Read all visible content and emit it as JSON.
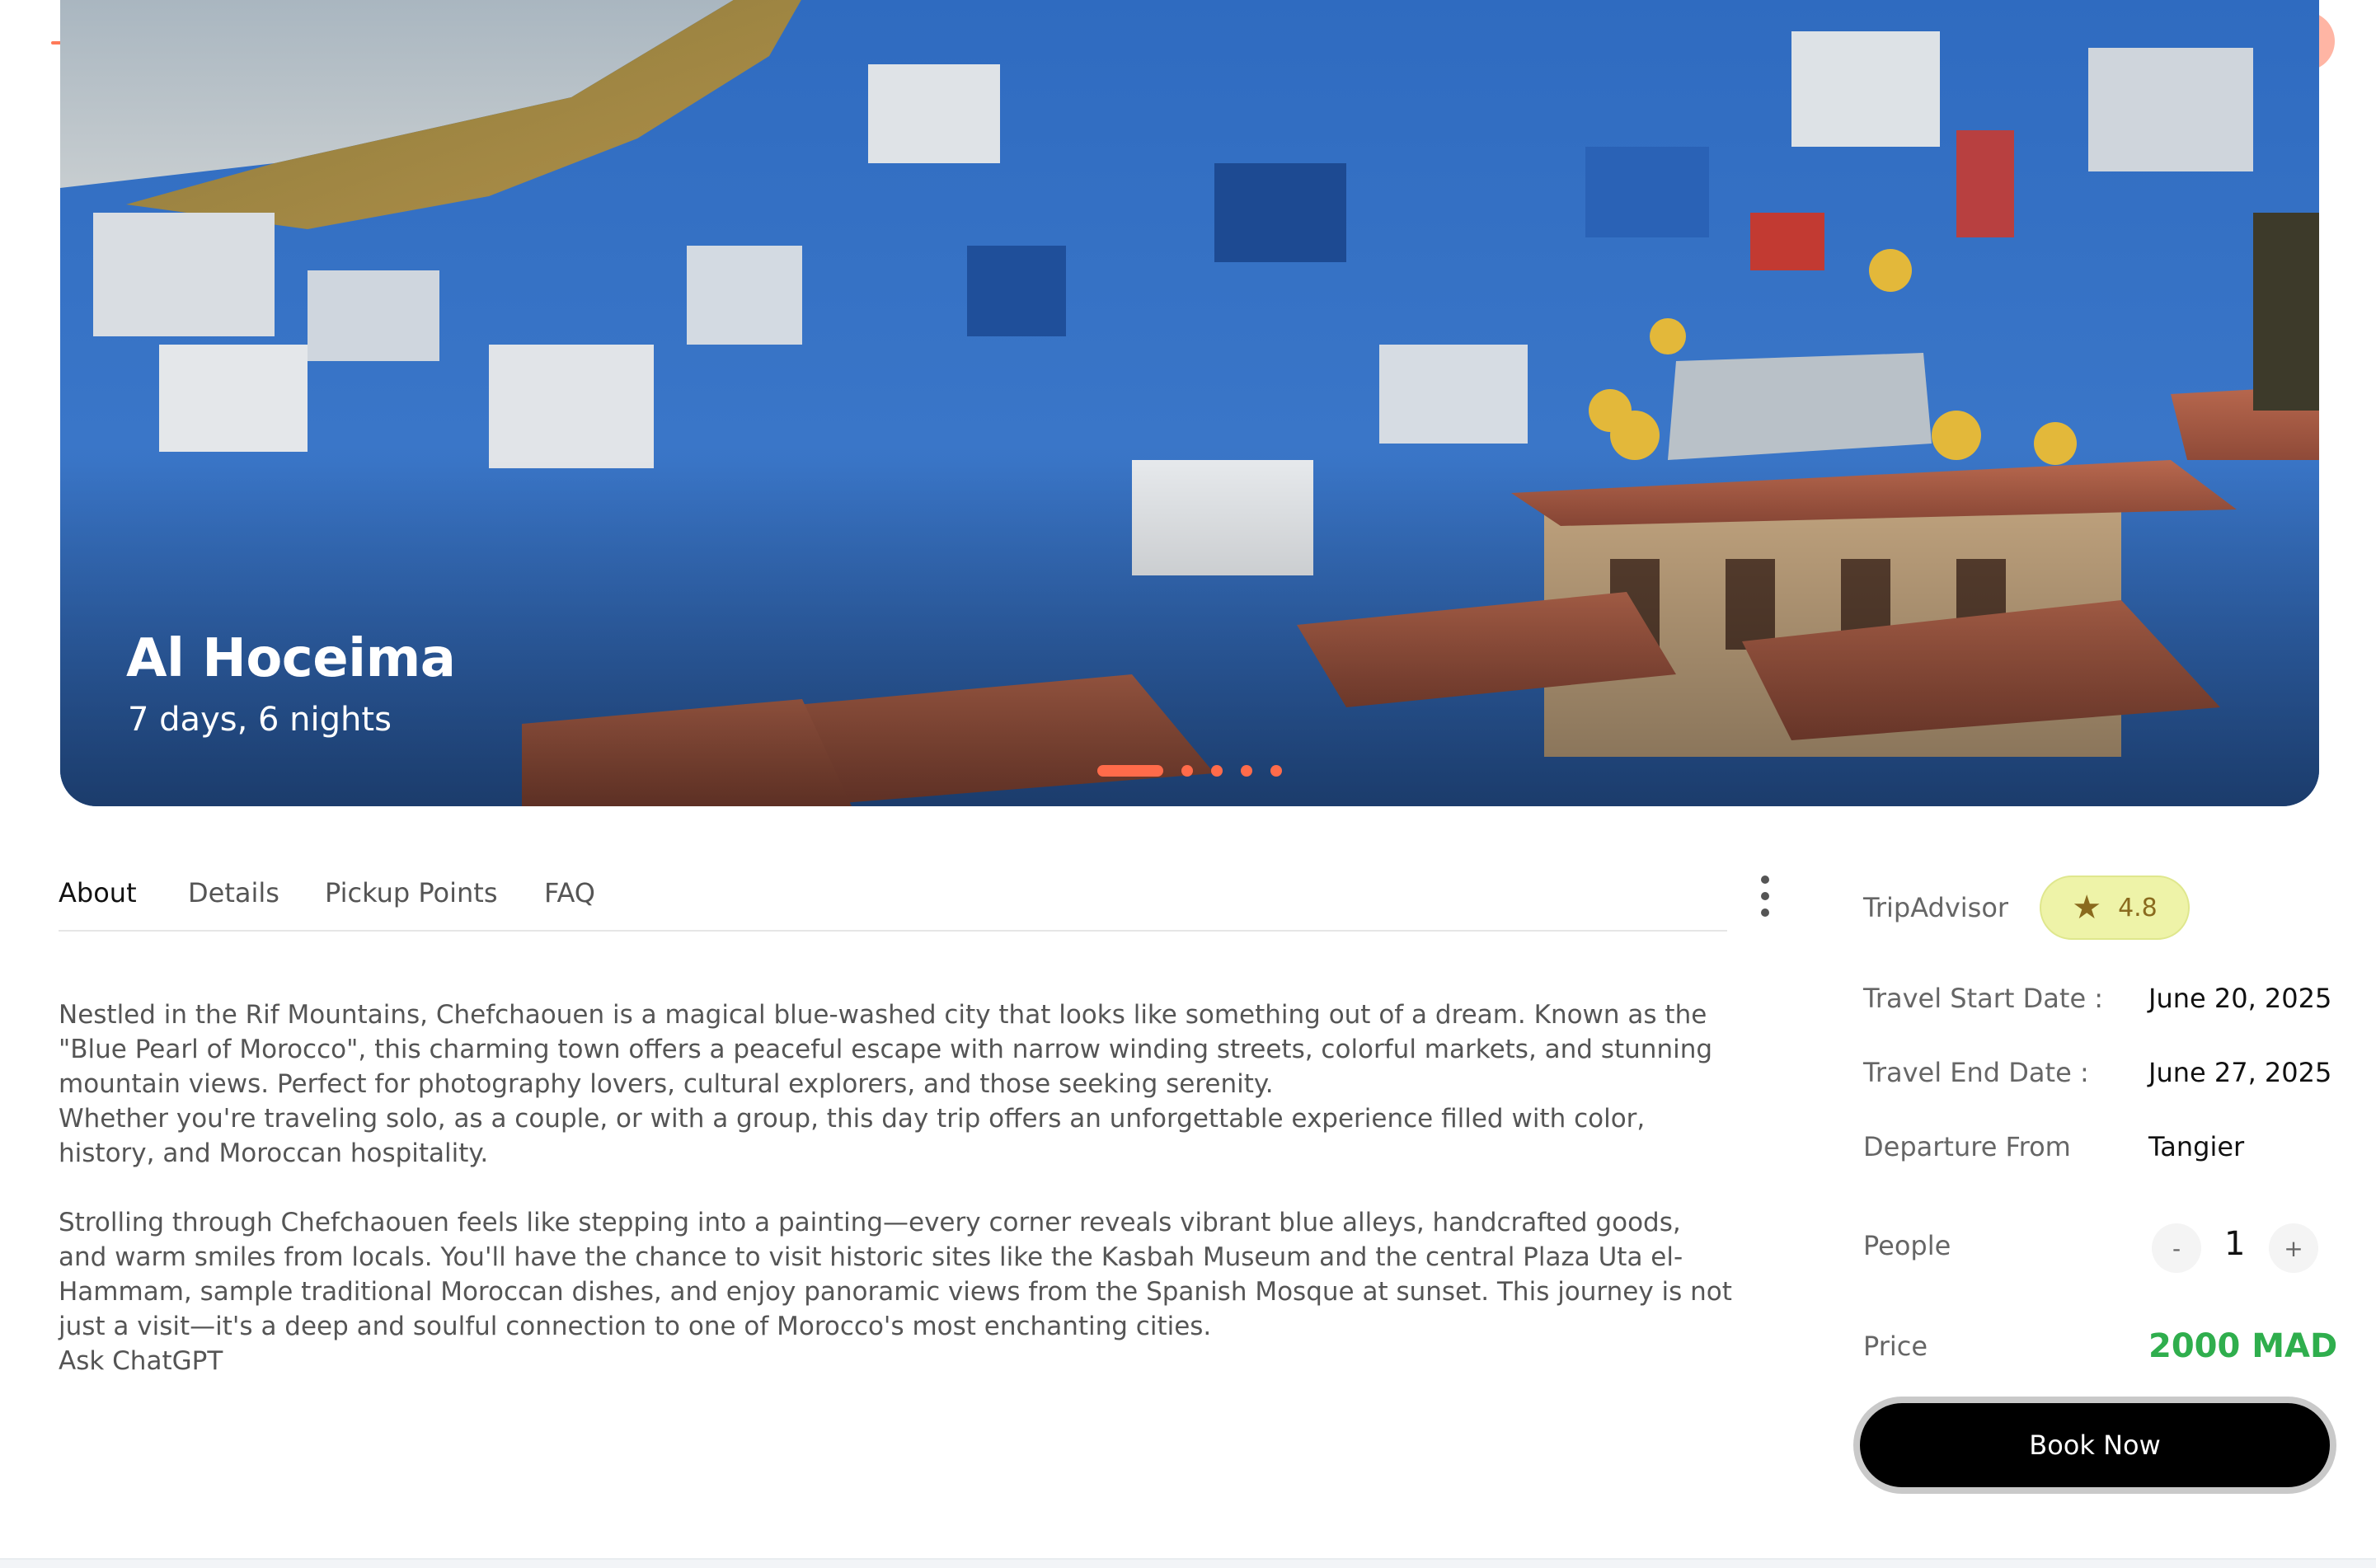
{
  "hero": {
    "title": "Al Hoceima",
    "subtitle": "7 days, 6 nights",
    "slides_total": 5,
    "slide_active": 1
  },
  "tabs": [
    {
      "label": "About",
      "active": true
    },
    {
      "label": "Details",
      "active": false
    },
    {
      "label": "Pickup Points",
      "active": false
    },
    {
      "label": "FAQ",
      "active": false
    }
  ],
  "about": {
    "p1": "Nestled in the Rif Mountains, Chefchaouen is a magical blue-washed city that looks like something out of a dream. Known as the \"Blue Pearl of Morocco\", this charming town offers a peaceful escape with narrow winding streets, colorful markets, and stunning mountain views. Perfect for photography lovers, cultural explorers, and those seeking serenity.",
    "p2": "Whether you're traveling solo, as a couple, or with a group, this day trip offers an unforgettable experience filled with color, history, and Moroccan hospitality.",
    "p3": "Strolling through Chefchaouen feels like stepping into a painting—every corner reveals vibrant blue alleys, handcrafted goods, and warm smiles from locals. You'll have the chance to visit historic sites like the Kasbah Museum and the central Plaza Uta el-Hammam, sample traditional Moroccan dishes, and enjoy panoramic views from the Spanish Mosque at sunset. This journey is not just a visit—it's a deep and soulful connection to one of Morocco's most enchanting cities.",
    "p4": "Ask ChatGPT"
  },
  "side": {
    "rating_source": "TripAdvisor",
    "rating_value": "4.8",
    "start_label": "Travel Start Date :",
    "start_value": "June 20, 2025",
    "end_label": "Travel End Date :",
    "end_value": "June 27, 2025",
    "departure_label": "Departure From",
    "departure_value": "Tangier",
    "people_label": "People",
    "people_minus": "-",
    "people_value": "1",
    "people_plus": "+",
    "price_label": "Price",
    "price_value": "2000 MAD",
    "book_label": "Book Now"
  },
  "colors": {
    "accent": "#ff6b4a",
    "price_green": "#2fae4d",
    "rating_bg": "#eef3a8"
  }
}
